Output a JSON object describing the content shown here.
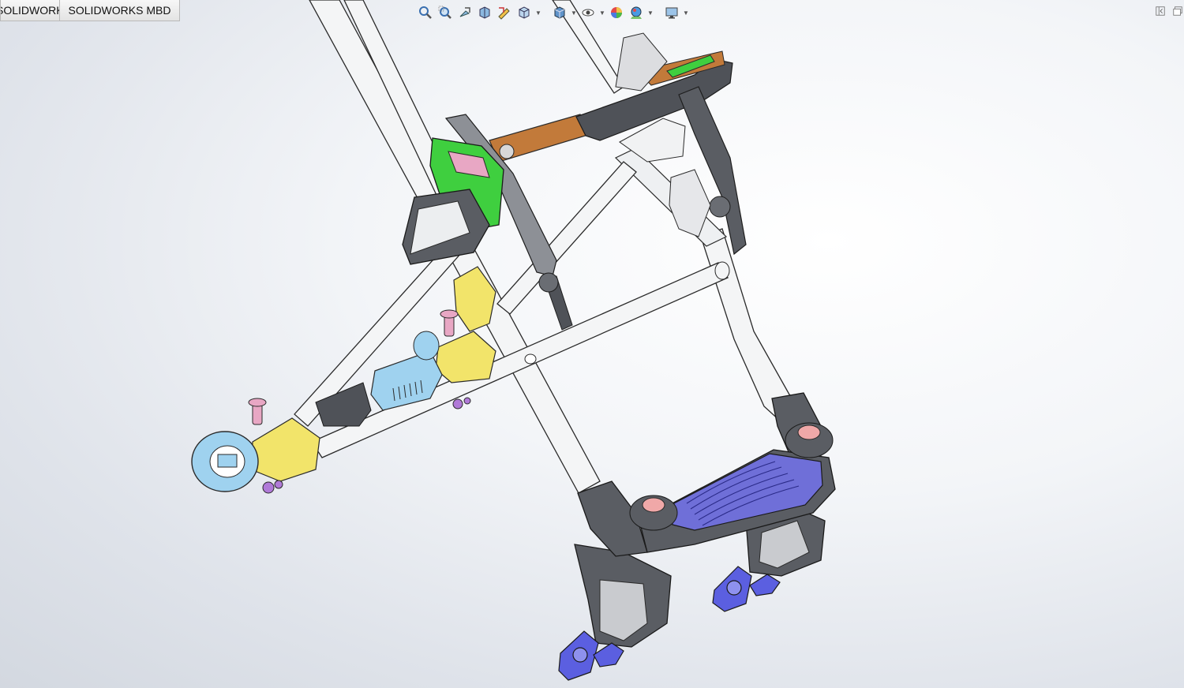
{
  "tabs": [
    {
      "label": "SOLIDWORKS 插件"
    },
    {
      "label": "SOLIDWORKS MBD"
    }
  ],
  "heads_up_toolbar": [
    {
      "icon": "zoom-to-fit-icon"
    },
    {
      "icon": "zoom-to-area-icon"
    },
    {
      "icon": "previous-view-icon"
    },
    {
      "icon": "section-view-icon"
    },
    {
      "icon": "dynamic-annotation-views-icon"
    },
    {
      "icon": "view-orientation-icon"
    },
    {
      "icon": "display-style-icon"
    },
    {
      "icon": "hide-show-items-icon"
    },
    {
      "icon": "edit-appearance-icon"
    },
    {
      "icon": "apply-scene-icon"
    },
    {
      "icon": "view-settings-icon"
    }
  ],
  "side_buttons": [
    {
      "icon": "collapse-panel-icon"
    },
    {
      "icon": "restore-window-icon"
    }
  ],
  "colors": {
    "frame_white": "#f4f5f6",
    "frame_outline": "#2a2a2a",
    "handle_dark": "#4f5258",
    "handle_brown": "#c27a3a",
    "grip_green": "#3fcf3f",
    "bracket_yellow": "#f2e46a",
    "hub_blue": "#9fd2ef",
    "footrest_purple": "#6f6fd8",
    "caster_blue": "#5b5fe0",
    "knob_pink": "#e8a7c4",
    "cap_pink": "#f0a8a8"
  }
}
